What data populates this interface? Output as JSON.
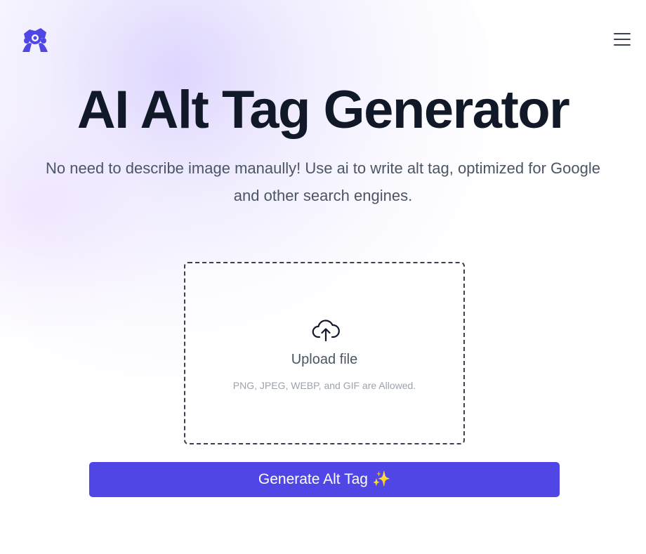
{
  "header": {
    "logo_icon": "camera-people-logo-icon",
    "menu_icon": "hamburger-menu-icon"
  },
  "hero": {
    "title": "AI Alt Tag Generator",
    "subtitle": "No need to describe image manaully! Use ai to write alt tag, optimized for Google and other search engines."
  },
  "upload": {
    "icon": "cloud-upload-icon",
    "label": "Upload file",
    "hint": "PNG, JPEG, WEBP, and GIF are Allowed."
  },
  "generate": {
    "label": "Generate Alt Tag",
    "sparkle": "✨"
  },
  "colors": {
    "accent": "#4f46e5",
    "title": "#111827",
    "body_text": "#4b5563",
    "hint_text": "#9ca3af"
  }
}
